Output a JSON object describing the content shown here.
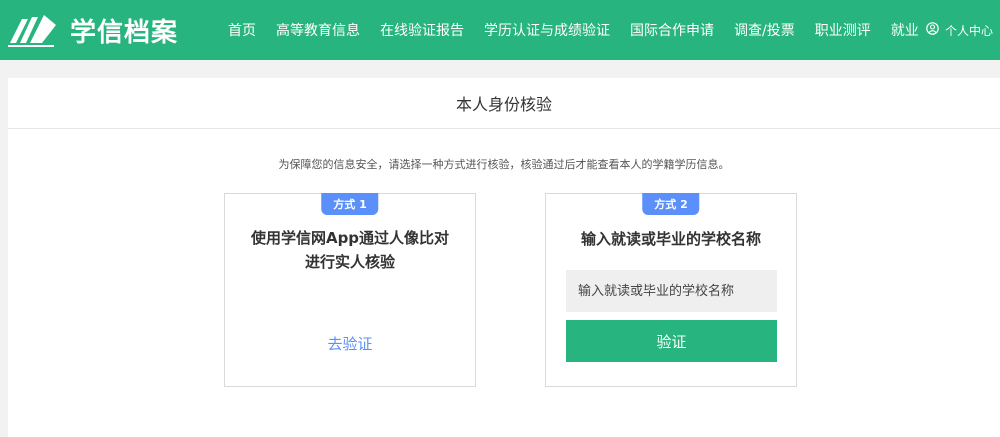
{
  "brand": {
    "name": "学信档案",
    "color": "#27b47e",
    "logo_icon": "book-icon"
  },
  "nav": {
    "items": [
      "首页",
      "高等教育信息",
      "在线验证报告",
      "学历认证与成绩验证",
      "国际合作申请",
      "调查/投票",
      "职业测评",
      "就业"
    ],
    "user_icon": "user-circle-icon",
    "user_label": "个人中心"
  },
  "page": {
    "title": "本人身份核验",
    "notice": "为保障您的信息安全，请选择一种方式进行核验，核验通过后才能查看本人的学籍学历信息。"
  },
  "method1": {
    "badge": "方式 1",
    "title_line1": "使用学信网App通过人像比对",
    "title_line2": "进行实人核验",
    "link": "去验证"
  },
  "method2": {
    "badge": "方式 2",
    "title": "输入就读或毕业的学校名称",
    "input_value": "",
    "input_placeholder": "输入就读或毕业的学校名称",
    "button": "验证"
  },
  "colors": {
    "accent": "#27b47e",
    "badge": "#5b8ff9",
    "link": "#5b8ff9"
  }
}
